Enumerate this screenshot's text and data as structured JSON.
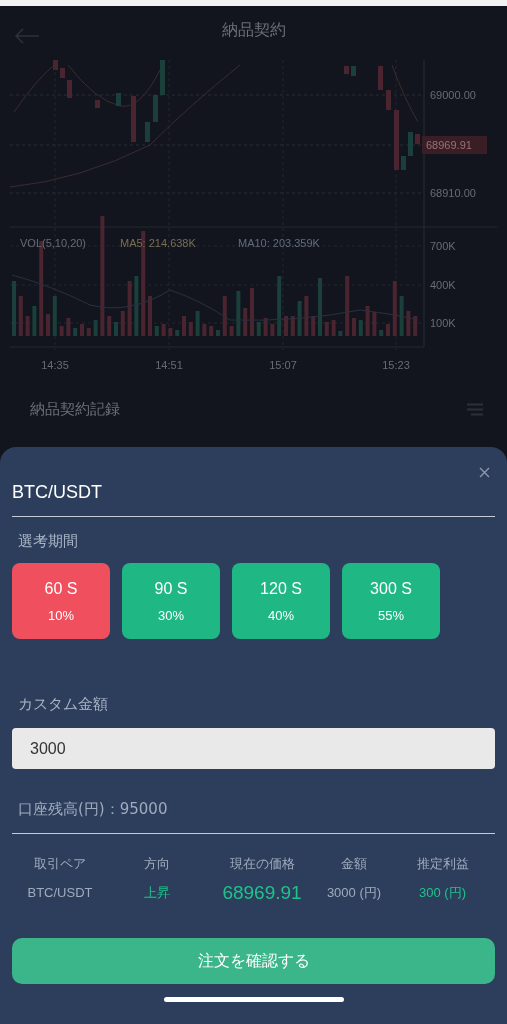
{
  "header": {
    "title": "納品契約"
  },
  "chart": {
    "price_labels": [
      "69000.00",
      "68910.00"
    ],
    "price_tag": "68969.91",
    "legend": [
      "VOL(5,10,20)",
      "MA5: 214.638K",
      "MA10: 203.359K"
    ],
    "volume_labels": [
      "700K",
      "400K",
      "100K"
    ],
    "time_labels": [
      "14:35",
      "14:51",
      "15:07",
      "15:23"
    ]
  },
  "records": {
    "title": "納品契約記録"
  },
  "sheet": {
    "pair": "BTC/USDT",
    "period_label": "選考期間",
    "periods": [
      {
        "label": "60 S",
        "percent": "10%",
        "selected": true
      },
      {
        "label": "90 S",
        "percent": "30%",
        "selected": false
      },
      {
        "label": "120 S",
        "percent": "40%",
        "selected": false
      },
      {
        "label": "300 S",
        "percent": "55%",
        "selected": false
      }
    ],
    "amount_label": "カスタム金額",
    "amount_value": "3000",
    "balance": "口座残高(円)：95000",
    "summary": [
      {
        "header": "取引ペア",
        "value": "BTC/USDT",
        "kind": "plain"
      },
      {
        "header": "方向",
        "value": "上昇",
        "kind": "up"
      },
      {
        "header": "現在の価格",
        "value": "68969.91",
        "kind": "price"
      },
      {
        "header": "金額",
        "value": "3000 (円)",
        "kind": "plain"
      },
      {
        "header": "推定利益",
        "value": "300 (円)",
        "kind": "up"
      }
    ],
    "confirm": "注文を確認する"
  }
}
